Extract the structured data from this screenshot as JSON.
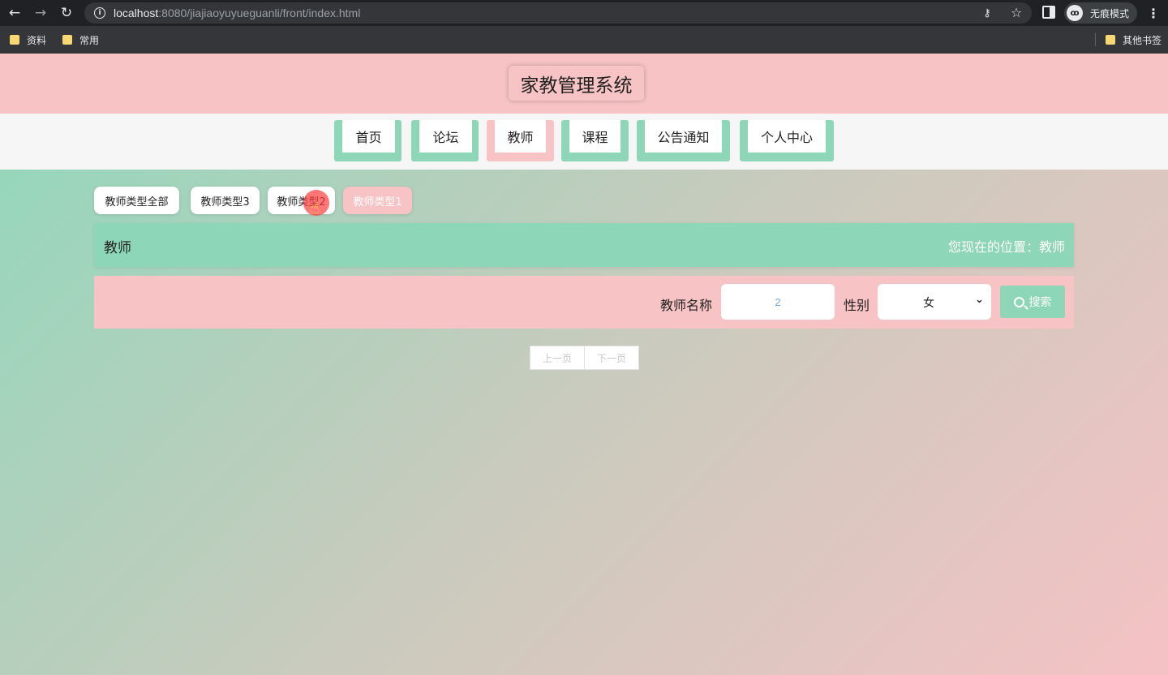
{
  "browser": {
    "url_host": "localhost",
    "url_path": ":8080/jiajiaoyuyueguanli/front/index.html",
    "incognito_label": "无痕模式",
    "bookmarks": [
      "资料",
      "常用"
    ],
    "other_bookmarks": "其他书签"
  },
  "site": {
    "title": "家教管理系统"
  },
  "nav": {
    "items": [
      "首页",
      "论坛",
      "教师",
      "课程",
      "公告通知",
      "个人中心"
    ],
    "active": "教师"
  },
  "type_filters": {
    "items": [
      "教师类型全部",
      "教师类型3",
      "教师类型2",
      "教师类型1"
    ],
    "active": "教师类型1"
  },
  "breadcrumb": {
    "title": "教师",
    "location": "您现在的位置：教师"
  },
  "search": {
    "name_label": "教师名称",
    "name_value": "2",
    "gender_label": "性别",
    "gender_value": "女",
    "button_label": "搜索"
  },
  "pager": {
    "prev": "上一页",
    "next": "下一页"
  },
  "colors": {
    "mint": "#8dd6b7",
    "pink": "#f8c3c4"
  },
  "icons": [
    "back-icon",
    "forward-icon",
    "reload-icon",
    "info-icon",
    "key-icon",
    "star-icon",
    "side-panel-icon",
    "incognito-icon",
    "menu-icon",
    "folder-icon",
    "search-icon",
    "chevron-down-icon"
  ]
}
